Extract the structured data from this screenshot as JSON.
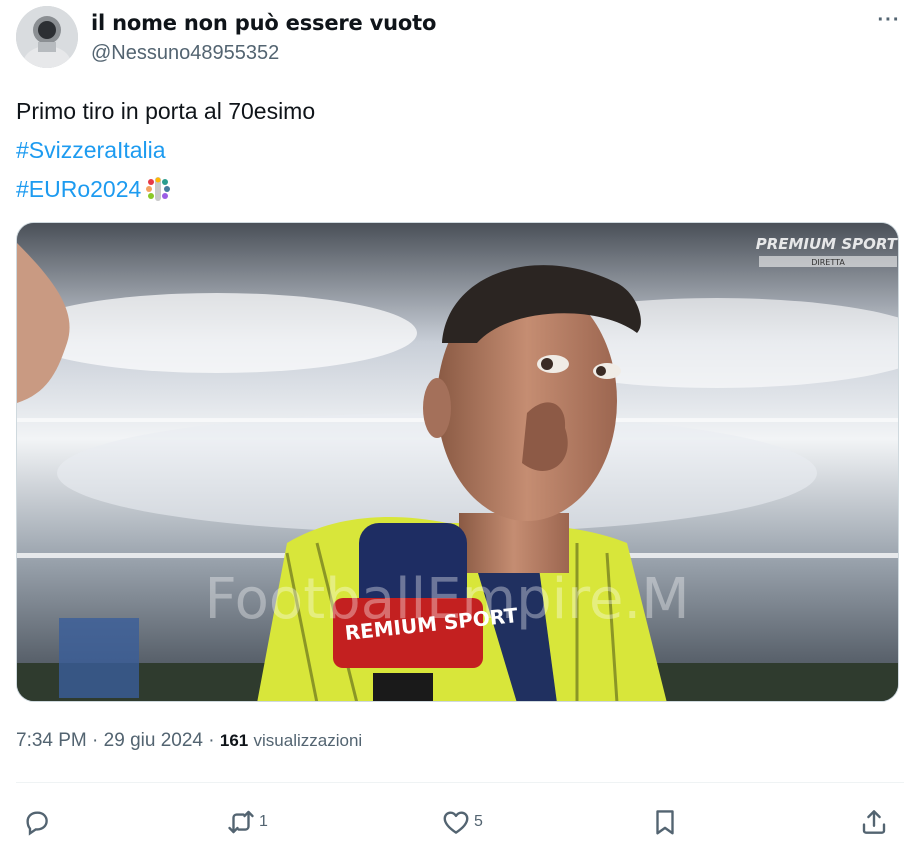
{
  "author": {
    "display_name": "il nome non può essere vuoto",
    "handle": "@Nessuno48955352"
  },
  "more_label": "···",
  "tweet": {
    "text": "Primo tiro in porta al 70esimo",
    "hashtags": [
      "#SvizzeraItalia",
      "#EURo2024"
    ]
  },
  "media": {
    "broadcaster": "PREMIUM SPORT",
    "live_label": "DIRETTA",
    "watermark": "FootballEmpire.M",
    "mic_flag": "REMIUM SPORT"
  },
  "meta": {
    "time": "7:34 PM",
    "separator": "·",
    "date": "29 giu 2024",
    "views_count": "161",
    "views_label": "visualizzazioni"
  },
  "actions": {
    "reply_icon": "reply-icon",
    "retweet_count": "1",
    "like_count": "5",
    "bookmark_icon": "bookmark-icon",
    "share_icon": "share-icon"
  },
  "colors": {
    "link": "#1d9bf0",
    "secondary_text": "#536471",
    "primary_text": "#0f1419",
    "jersey": "#d8e63a"
  }
}
